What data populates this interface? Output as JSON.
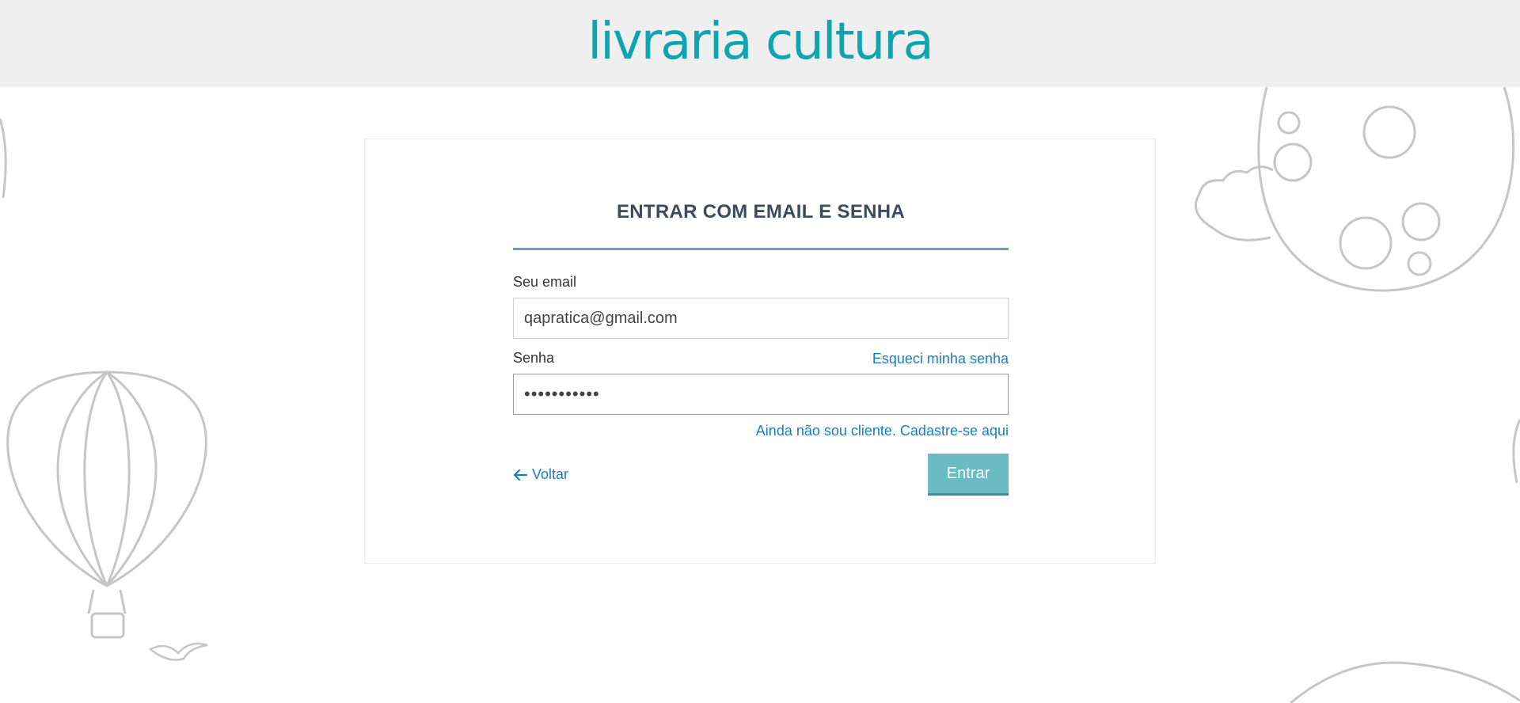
{
  "header": {
    "logo_text": "livraria cultura",
    "brand_color": "#10a4b0"
  },
  "form": {
    "title": "ENTRAR COM EMAIL E SENHA",
    "email_label": "Seu email",
    "email_value": "qapratica@gmail.com",
    "password_label": "Senha",
    "password_value": "•••••••••••",
    "forgot_link": "Esqueci minha senha",
    "register_link": "Ainda não sou cliente. Cadastre-se aqui",
    "back_label": "Voltar",
    "back_icon": "arrow-left-icon",
    "submit_label": "Entrar"
  },
  "colors": {
    "accent_line": "#6f9bc6",
    "link": "#1a7fc1",
    "button": "#6bbcc2",
    "title": "#3b4a5c"
  },
  "background": {
    "illustrations": [
      "hot-air-balloon-icon",
      "bird-icon",
      "moon-icon",
      "cloud-icon"
    ]
  }
}
